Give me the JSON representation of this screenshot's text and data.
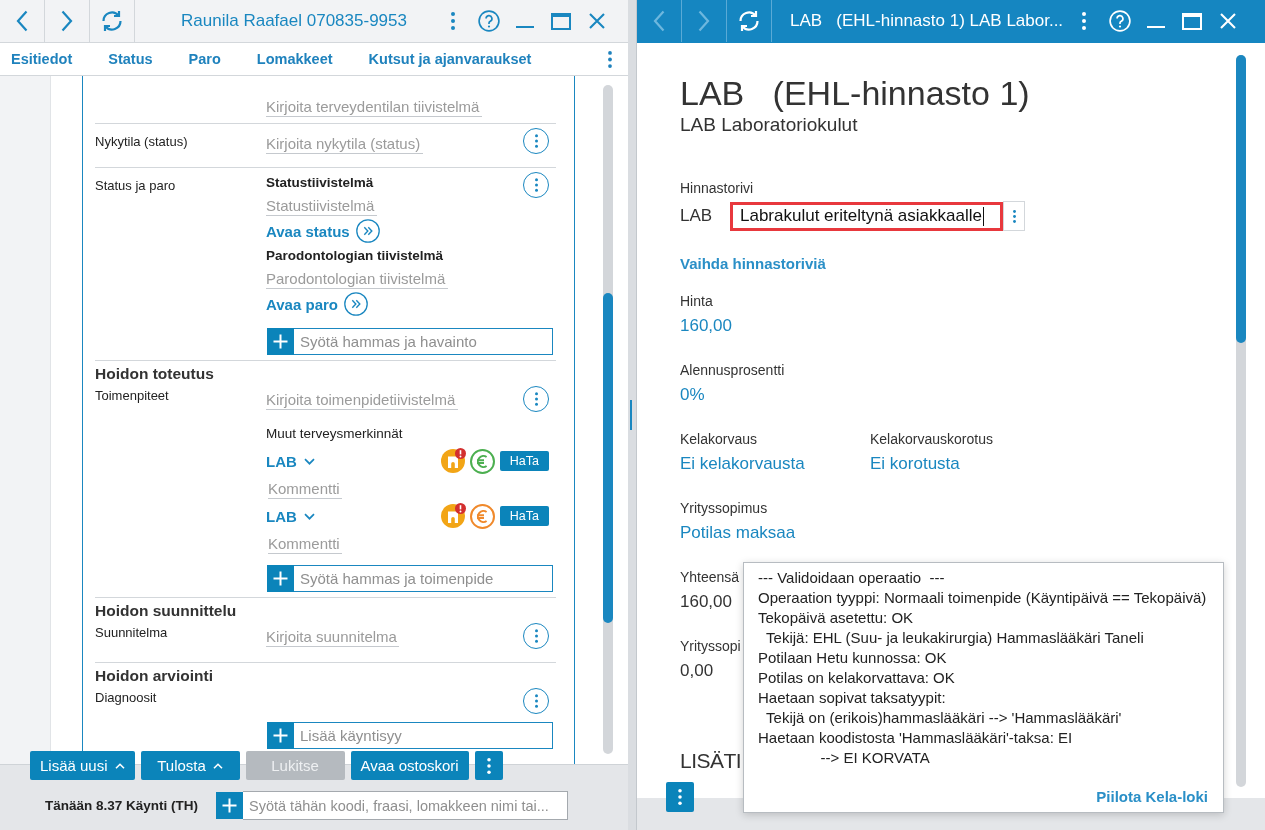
{
  "left_window": {
    "nav_buttons": [
      {
        "kind": "back",
        "disabled": false
      },
      {
        "kind": "forward",
        "disabled": false
      },
      {
        "kind": "refresh",
        "disabled": false
      }
    ],
    "title": "Raunila Raafael 070835-9953",
    "tabs": [
      "Esitiedot",
      "Status",
      "Paro",
      "Lomakkeet",
      "Kutsut ja ajanvaraukset"
    ],
    "record_blocks": [
      {
        "menu": false,
        "items": [
          {
            "kind": "text_field",
            "placeholder": "Kirjoita terveydentilan tiivistelmä"
          }
        ]
      },
      {
        "label": "Nykytila (status)",
        "menu": true,
        "items": [
          {
            "kind": "text_field",
            "placeholder": "Kirjoita nykytila (status)"
          }
        ]
      },
      {
        "label": "Status ja paro",
        "menu": true,
        "items": [
          {
            "kind": "subheading",
            "text": "Statustiivistelmä"
          },
          {
            "kind": "text_field",
            "placeholder": "Statustiivistelmä"
          },
          {
            "kind": "link",
            "text": "Avaa status"
          },
          {
            "kind": "subheading",
            "text": "Parodontologian tiivistelmä"
          },
          {
            "kind": "text_field",
            "placeholder": "Parodontologian tiivistelmä"
          },
          {
            "kind": "link",
            "text": "Avaa paro"
          },
          {
            "kind": "add_field",
            "placeholder": "Syötä hammas ja havainto"
          }
        ]
      },
      {
        "heading": "Hoidon toteutus",
        "label": "Toimenpiteet",
        "menu": true,
        "items": [
          {
            "kind": "text_field",
            "placeholder": "Kirjoita toimenpidetiivistelmä"
          },
          {
            "kind": "note",
            "text": "Muut terveysmerkinnät"
          },
          {
            "kind": "procedure",
            "code": "LAB",
            "alert": true,
            "color": "#4caf50",
            "tag": "HaTa",
            "comment_placeholder": "Kommentti"
          },
          {
            "kind": "procedure",
            "code": "LAB",
            "alert": true,
            "color": "#f0892b",
            "tag": "HaTa",
            "comment_placeholder": "Kommentti"
          },
          {
            "kind": "add_field",
            "placeholder": "Syötä hammas ja toimenpide"
          }
        ]
      },
      {
        "heading": "Hoidon suunnittelu",
        "label": "Suunnitelma",
        "menu": true,
        "items": [
          {
            "kind": "text_field",
            "placeholder": "Kirjoita suunnitelma"
          }
        ]
      },
      {
        "heading": "Hoidon arviointi",
        "label": "Diagnoosit",
        "menu": true,
        "items": [
          {
            "kind": "add_field",
            "placeholder": "Lisää käyntisyy"
          }
        ]
      }
    ],
    "actions": [
      {
        "label": "Lisää uusi",
        "kind": "dropdown",
        "disabled": false
      },
      {
        "label": "Tulosta",
        "kind": "dropdown",
        "disabled": false
      },
      {
        "label": "Lukitse",
        "kind": "plain",
        "disabled": true
      },
      {
        "label": "Avaa ostoskori",
        "kind": "plain",
        "disabled": false
      }
    ],
    "visit": "Tänään 8.37 Käynti (TH)",
    "quick_entry": {
      "placeholder": "Syötä tähän koodi, fraasi, lomakkeen nimi tai..."
    }
  },
  "right_window": {
    "nav_buttons": [
      {
        "kind": "back",
        "disabled": true
      },
      {
        "kind": "forward",
        "disabled": true
      },
      {
        "kind": "refresh",
        "disabled": false
      }
    ],
    "title": "LAB   (EHL-hinnasto 1) LAB Labor...",
    "heading": "LAB   (EHL-hinnasto 1)",
    "subheading": "LAB Laboratoriokulut",
    "price_row": {
      "label": "Hinnastorivi",
      "code": "LAB",
      "value": "Labrakulut eriteltynä asiakkaalle",
      "highlighted": true,
      "focused": true
    },
    "change_link": "Vaihda hinnastoriviä",
    "field_rows": [
      [
        {
          "label": "Hinta",
          "value": "160,00",
          "kind": "link"
        }
      ],
      [
        {
          "label": "Alennusprosentti",
          "value": "0%",
          "kind": "link"
        }
      ],
      [
        {
          "label": "Kelakorvaus",
          "value": "Ei kelakorvausta",
          "kind": "link"
        },
        {
          "label": "Kelakorvauskorotus",
          "value": "Ei korotusta",
          "kind": "link"
        }
      ],
      [
        {
          "label": "Yrityssopimus",
          "value": "Potilas maksaa",
          "kind": "link"
        }
      ],
      [
        {
          "label": "Yhteensä",
          "value": "160,00",
          "kind": "text"
        }
      ],
      [
        {
          "label": "Yrityssopi",
          "value": "0,00",
          "kind": "text"
        }
      ]
    ],
    "section_heading": "LISÄTI",
    "kela_log": {
      "lines": [
        "--- Validoidaan operaatio  ---",
        "Operaation tyyppi: Normaali toimenpide (Käyntipäivä == Tekopäivä)",
        "Tekopäivä asetettu: OK",
        "  Tekijä: EHL (Suu- ja leukakirurgia) Hammaslääkäri Taneli",
        "Potilaan Hetu kunnossa: OK",
        "Potilas on kelakorvattava: OK",
        "Haetaan sopivat taksatyypit:",
        "  Tekijä on (erikois)hammaslääkäri --> 'Hammaslääkäri'",
        "Haetaan koodistosta 'Hammaslääkäri'-taksa: EI",
        "               --> EI KORVATA"
      ],
      "hide_link": "Piilota Kela-loki"
    }
  }
}
